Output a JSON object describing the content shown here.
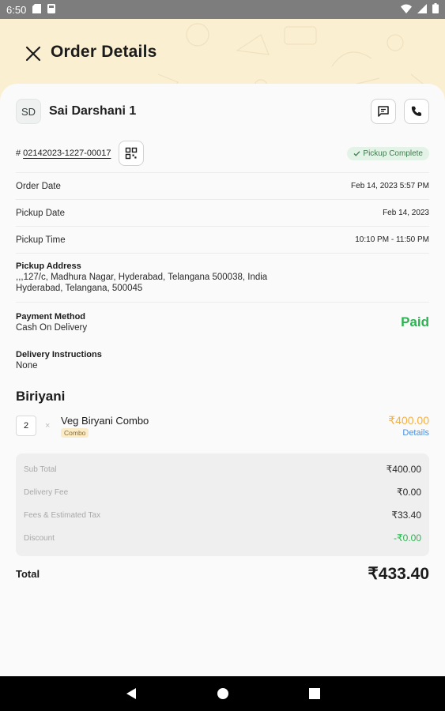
{
  "status_bar": {
    "time": "6:50"
  },
  "header": {
    "title": "Order Details"
  },
  "customer": {
    "initials": "SD",
    "name": "Sai Darshani 1"
  },
  "order": {
    "hash": "#",
    "number": "02142023-1227-00017",
    "status": "Pickup Complete"
  },
  "info": {
    "order_date_label": "Order Date",
    "order_date_value": "Feb 14, 2023 5:57 PM",
    "pickup_date_label": "Pickup Date",
    "pickup_date_value": "Feb 14, 2023",
    "pickup_time_label": "Pickup Time",
    "pickup_time_value": "10:10 PM - 11:50 PM",
    "pickup_address_label": "Pickup Address",
    "pickup_address_line1": ",,,127/c, Madhura Nagar, Hyderabad, Telangana 500038, India",
    "pickup_address_line2": "Hyderabad, Telangana, 500045",
    "payment_method_label": "Payment Method",
    "payment_method_value": "Cash On Delivery",
    "payment_status": "Paid",
    "delivery_instructions_label": "Delivery Instructions",
    "delivery_instructions_value": "None"
  },
  "section": {
    "title": "Biriyani"
  },
  "items": [
    {
      "qty": "2",
      "times": "×",
      "name": "Veg Biryani Combo",
      "tag": "Combo",
      "price": "₹400.00",
      "details_label": "Details"
    }
  ],
  "summary": {
    "subtotal_label": "Sub Total",
    "subtotal_value": "₹400.00",
    "delivery_label": "Delivery Fee",
    "delivery_value": "₹0.00",
    "fees_label": "Fees & Estimated Tax",
    "fees_value": "₹33.40",
    "discount_label": "Discount",
    "discount_value": "-₹0.00"
  },
  "total": {
    "label": "Total",
    "value": "₹433.40"
  },
  "colors": {
    "header_bg": "#fbefd2",
    "paid_green": "#2bb451",
    "price_orange": "#f5b042",
    "link_blue": "#4a90e2"
  }
}
